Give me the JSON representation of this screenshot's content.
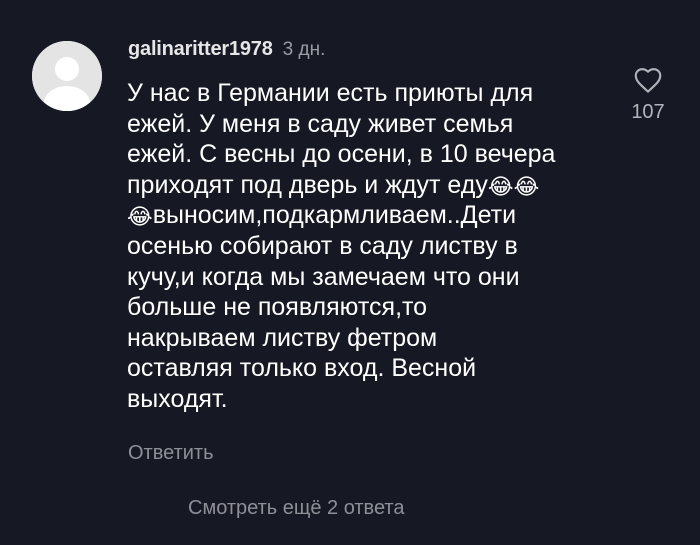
{
  "comment": {
    "username": "galinaritter1978",
    "timestamp": "3 дн.",
    "text_lines": [
      "У нас в Германии есть приюты для",
      "ежей. У меня в саду живет семья",
      "ежей. С весны до осени, в 10 вечера",
      "приходят под дверь и ждут еду"
    ],
    "emoji": [
      "😂",
      "😂",
      "😂"
    ],
    "text_lines_after": [
      "выносим,подкармливаем..Дети",
      "осенью собирают в саду листву в",
      "кучу,и когда мы замечаем что они",
      "больше не появляются,то",
      "накрываем листву фетром",
      "оставляя только вход. Весной",
      "выходят."
    ],
    "reply_label": "Ответить",
    "like_count": "107",
    "like_icon": "heart-outline-icon"
  },
  "view_more_label": "Смотреть ещё 2 ответа",
  "colors": {
    "background": "#161823",
    "text": "#ffffff",
    "muted": "#8e8f97"
  }
}
